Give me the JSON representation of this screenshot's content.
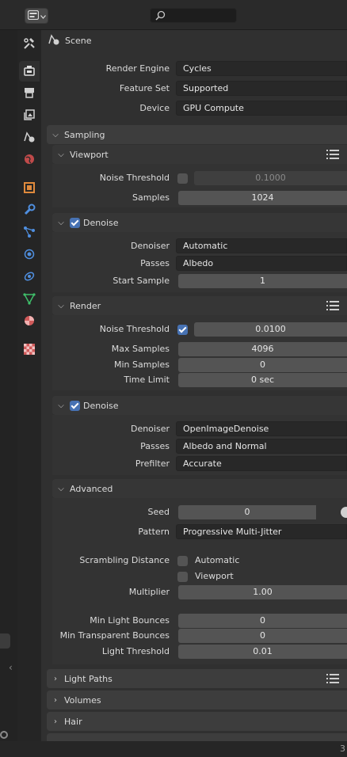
{
  "header": {
    "editor_type_icon": "properties-icon",
    "search_placeholder": ""
  },
  "tabs": [
    {
      "name": "tool",
      "icon": "tool-icon",
      "active": false
    },
    {
      "name": "render",
      "icon": "render-icon",
      "active": true
    },
    {
      "name": "output",
      "icon": "output-icon",
      "active": false
    },
    {
      "name": "view-layer",
      "icon": "view-layer-icon",
      "active": false
    },
    {
      "name": "scene",
      "icon": "scene-icon",
      "active": false
    },
    {
      "name": "world",
      "icon": "world-icon",
      "active": false
    },
    {
      "name": "object",
      "icon": "object-icon",
      "active": false
    },
    {
      "name": "modifiers",
      "icon": "wrench-icon",
      "active": false
    },
    {
      "name": "particles",
      "icon": "particles-icon",
      "active": false
    },
    {
      "name": "physics",
      "icon": "physics-icon",
      "active": false
    },
    {
      "name": "constraints",
      "icon": "constraints-icon",
      "active": false
    },
    {
      "name": "data",
      "icon": "mesh-data-icon",
      "active": false
    },
    {
      "name": "material",
      "icon": "material-icon",
      "active": false
    },
    {
      "name": "texture",
      "icon": "texture-icon",
      "active": false
    }
  ],
  "context": {
    "label": "Scene"
  },
  "render": {
    "engine_label": "Render Engine",
    "engine_value": "Cycles",
    "feature_label": "Feature Set",
    "feature_value": "Supported",
    "device_label": "Device",
    "device_value": "GPU Compute"
  },
  "sampling": {
    "title": "Sampling",
    "viewport": {
      "title": "Viewport",
      "noise_threshold_label": "Noise Threshold",
      "noise_threshold_enabled": false,
      "noise_threshold_value": "0.1000",
      "samples_label": "Samples",
      "samples_value": "1024",
      "denoise_label": "Denoise",
      "denoise_enabled": true,
      "denoiser_label": "Denoiser",
      "denoiser_value": "Automatic",
      "passes_label": "Passes",
      "passes_value": "Albedo",
      "start_sample_label": "Start Sample",
      "start_sample_value": "1"
    },
    "render": {
      "title": "Render",
      "noise_threshold_label": "Noise Threshold",
      "noise_threshold_enabled": true,
      "noise_threshold_value": "0.0100",
      "max_samples_label": "Max Samples",
      "max_samples_value": "4096",
      "min_samples_label": "Min Samples",
      "min_samples_value": "0",
      "time_limit_label": "Time Limit",
      "time_limit_value": "0 sec",
      "denoise_label": "Denoise",
      "denoise_enabled": true,
      "denoiser_label": "Denoiser",
      "denoiser_value": "OpenImageDenoise",
      "passes_label": "Passes",
      "passes_value": "Albedo and Normal",
      "prefilter_label": "Prefilter",
      "prefilter_value": "Accurate"
    },
    "advanced": {
      "title": "Advanced",
      "seed_label": "Seed",
      "seed_value": "0",
      "pattern_label": "Pattern",
      "pattern_value": "Progressive Multi-Jitter",
      "scrambling_label": "Scrambling Distance",
      "automatic_label": "Automatic",
      "automatic_enabled": false,
      "viewport_label": "Viewport",
      "viewport_enabled": false,
      "multiplier_label": "Multiplier",
      "multiplier_value": "1.00",
      "min_light_bounces_label": "Min Light Bounces",
      "min_light_bounces_value": "0",
      "min_transparent_bounces_label": "Min Transparent Bounces",
      "min_transparent_bounces_value": "0",
      "light_threshold_label": "Light Threshold",
      "light_threshold_value": "0.01"
    }
  },
  "collapsed_panels": {
    "light_paths": "Light Paths",
    "volumes": "Volumes",
    "hair": "Hair"
  },
  "status": {
    "text": "3"
  },
  "colors": {
    "accent": "#4772b3",
    "panel_bg": "#303030",
    "field_bg": "#545454"
  }
}
